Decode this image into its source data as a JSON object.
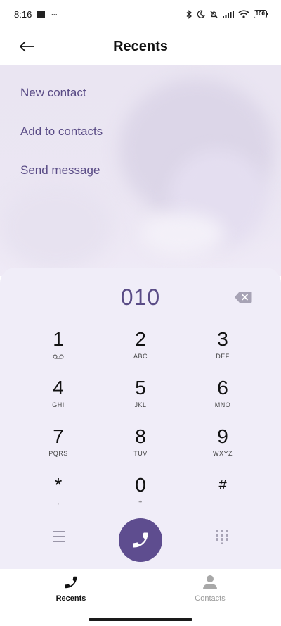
{
  "status_bar": {
    "time": "8:16",
    "dots": "···",
    "battery": "100",
    "icons": [
      "square-notification-icon",
      "bluetooth-icon",
      "moon-icon",
      "bell-off-icon",
      "signal-icon",
      "wifi-icon",
      "battery-icon"
    ]
  },
  "header": {
    "title": "Recents",
    "back_icon": "back-arrow-icon"
  },
  "menu": {
    "items": [
      "New contact",
      "Add to contacts",
      "Send message"
    ]
  },
  "dialpad": {
    "number": "010",
    "backspace_icon": "backspace-icon",
    "keys": [
      {
        "digit": "1",
        "sub": "voicemail-icon"
      },
      {
        "digit": "2",
        "sub": "ABC"
      },
      {
        "digit": "3",
        "sub": "DEF"
      },
      {
        "digit": "4",
        "sub": "GHI"
      },
      {
        "digit": "5",
        "sub": "JKL"
      },
      {
        "digit": "6",
        "sub": "MNO"
      },
      {
        "digit": "7",
        "sub": "PQRS"
      },
      {
        "digit": "8",
        "sub": "TUV"
      },
      {
        "digit": "9",
        "sub": "WXYZ"
      },
      {
        "digit": "*",
        "sub": ","
      },
      {
        "digit": "0",
        "sub": "+"
      },
      {
        "digit": "#",
        "sub": ""
      }
    ],
    "menu_icon": "hamburger-menu-icon",
    "call_icon": "phone-icon",
    "keypad_icon": "dialpad-grid-icon"
  },
  "bottom_nav": {
    "tabs": [
      {
        "label": "Recents",
        "icon": "phone-icon",
        "active": true
      },
      {
        "label": "Contacts",
        "icon": "person-icon",
        "active": false
      }
    ]
  },
  "colors": {
    "accent": "#5e4d8f",
    "menu_text": "#5a4c86",
    "dialpad_bg": "#f0edf8"
  }
}
